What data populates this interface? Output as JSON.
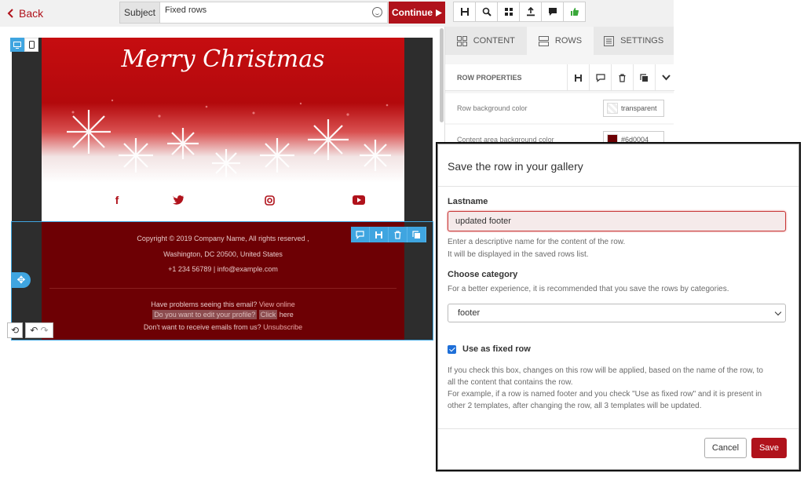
{
  "topbar": {
    "back_label": "Back",
    "subject_label": "Subject",
    "subject_value": "Fixed rows",
    "continue_label": "Continue",
    "tools": [
      "save-icon",
      "preview-icon",
      "grid-icon",
      "export-icon",
      "comment-icon",
      "approve-icon"
    ]
  },
  "email": {
    "header_title": "Merry Christmas",
    "social_icons": [
      {
        "name": "facebook-icon",
        "glyph": "f"
      },
      {
        "name": "twitter-icon",
        "glyph": "🐦"
      },
      {
        "name": "instagram-icon",
        "glyph": "◎"
      },
      {
        "name": "youtube-icon",
        "glyph": "▶"
      }
    ],
    "footer": {
      "copyright": "Copyright © 2019 Company Name, All rights reserved ,",
      "address": "Washington, DC 20500, United States",
      "contact": "+1 234 56789 | info@example.com",
      "view_online_prefix": "Have problems seeing this email?",
      "view_online_link": "View online",
      "edit_profile_text": "Do you want to edit your profile?",
      "edit_profile_click": "Click",
      "edit_profile_suffix": "here",
      "unsubscribe_prefix": "Don't want to receive emails from us?",
      "unsubscribe_link": "Unsubscribe"
    }
  },
  "panel": {
    "tabs": [
      {
        "label": "CONTENT",
        "active": false
      },
      {
        "label": "ROWS",
        "active": true
      },
      {
        "label": "SETTINGS",
        "active": false
      }
    ],
    "row_properties_title": "ROW PROPERTIES",
    "props": [
      {
        "label": "Row background color",
        "value": "transparent"
      },
      {
        "label": "Content area background color",
        "value": "#6d0004"
      }
    ]
  },
  "modal": {
    "title": "Save the row in your gallery",
    "name_label": "Lastname",
    "name_value": "updated footer",
    "name_help_1": "Enter a descriptive name for the content of the row.",
    "name_help_2": "It will be displayed in the saved rows list.",
    "category_label": "Choose category",
    "category_help": "For a better experience, it is recommended that you save the rows by categories.",
    "category_value": "footer",
    "fixed_label": "Use as fixed row",
    "fixed_checked": true,
    "fixed_help_1": "If you check this box, changes on this row will be applied, based on the name of the row, to",
    "fixed_help_2": "all the content that contains the row.",
    "fixed_help_3": "For example, if a row is named footer and you check \"Use as fixed row\" and it is present in",
    "fixed_help_4": "other 2 templates, after changing the row, all 3 templates will be updated.",
    "cancel_label": "Cancel",
    "save_label": "Save"
  },
  "colors": {
    "accent": "#b0121b",
    "selection_blue": "#3fa5e0",
    "footer_bg": "#6d0004"
  }
}
